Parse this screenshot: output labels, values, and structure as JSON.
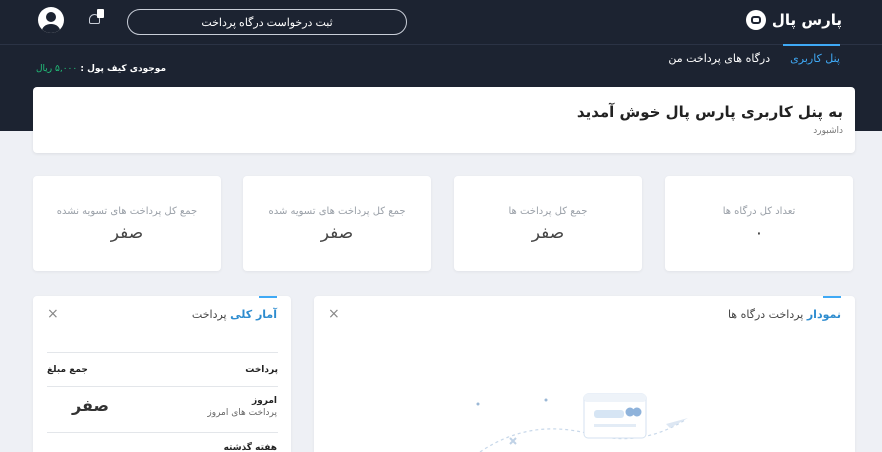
{
  "header": {
    "brand": "پارس پال",
    "request_button": "ثبت درخواست درگاه پرداخت",
    "nav": [
      "پنل کاربری",
      "درگاه های پرداخت من"
    ],
    "wallet_label": "موجودی کیف پول :",
    "wallet_amount": "۵,۰۰۰ ریال"
  },
  "welcome": {
    "title": "به پنل کاربری پارس پال خوش آمدید",
    "subtitle": "داشبورد"
  },
  "stats": [
    {
      "label": "تعداد کل درگاه ها",
      "value": "۰"
    },
    {
      "label": "جمع کل پرداخت ها",
      "value": "صفر"
    },
    {
      "label": "جمع کل پرداخت های تسویه شده",
      "value": "صفر"
    },
    {
      "label": "جمع کل پرداخت های تسویه نشده",
      "value": "صفر"
    }
  ],
  "chart_panel": {
    "title_hl": "نمودار",
    "title_rest": " پرداخت درگاه ها",
    "close": "×"
  },
  "stats_panel": {
    "title_hl": "آمار کلی",
    "title_rest": " پرداخت",
    "close": "×",
    "col_payment": "پرداخت",
    "col_sum": "جمع مبلغ",
    "rows": [
      {
        "title": "امروز",
        "sub": "پرداخت های امروز",
        "value": "صفر"
      },
      {
        "title": "هفته گذشته",
        "sub": "",
        "value": ""
      }
    ]
  }
}
